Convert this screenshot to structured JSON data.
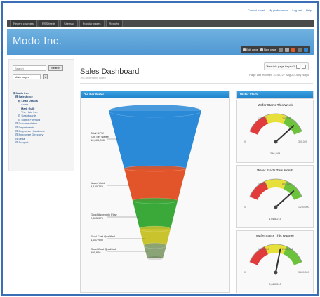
{
  "top_links": [
    "Control panel",
    "My preferences",
    "Log out",
    "Help"
  ],
  "nav": [
    "Recent changes",
    "RSS feeds",
    "Sitemap",
    "Popular pages",
    "Reports"
  ],
  "brand": "Modo Inc.",
  "tools": {
    "edit_page": "Edit page",
    "new_page": "New page"
  },
  "sidebar": {
    "search_placeholder": "Search",
    "search_button": "Search",
    "filter_value": "Main pages",
    "tree": [
      {
        "label": "Modo Inc.",
        "depth": 0,
        "bold": true
      },
      {
        "label": "Salesforce",
        "depth": 1,
        "bold": true
      },
      {
        "label": "Lead Details",
        "depth": 2,
        "bold": true
      },
      {
        "label": "Acme",
        "depth": 3,
        "bold": false
      },
      {
        "label": "Mark Gulli",
        "depth": 3,
        "bold": true
      },
      {
        "label": "The Hair, Inc.",
        "depth": 3,
        "bold": false
      },
      {
        "label": "Dashboards",
        "depth": 2,
        "bold": false
      },
      {
        "label": "Matrix Formula",
        "depth": 2,
        "bold": false
      },
      {
        "label": "Documentation",
        "depth": 1,
        "bold": false
      },
      {
        "label": "Departments",
        "depth": 1,
        "bold": false
      },
      {
        "label": "Employee Handbook",
        "depth": 1,
        "bold": false
      },
      {
        "label": "Employee Directory",
        "depth": 1,
        "bold": false
      },
      {
        "label": "Legal",
        "depth": 1,
        "bold": false
      },
      {
        "label": "Support",
        "depth": 1,
        "bold": false
      }
    ]
  },
  "page": {
    "title": "Sales Dashboard",
    "subtitle": "This page will be edited",
    "helpful_label": "Was this page helpful?",
    "modified": "Page last modified 10:42, 27 Aug 2014 by jsogo"
  },
  "funnel_panel": {
    "title": "Die Per Wafer",
    "stages": [
      {
        "label": "Total DPW",
        "sub": "(Die per wafer)",
        "value": "10,000,000",
        "color": "#2a8ad8"
      },
      {
        "label": "Wafer Yield",
        "sub": "",
        "value": "9,130,770",
        "color": "#e2552a"
      },
      {
        "label": "Good Assembly Flow",
        "sub": "",
        "value": "2,653,076",
        "color": "#3aa93a"
      },
      {
        "label": "Final Cost Qualified",
        "sub": "",
        "value": "1,637,930",
        "color": "#c9c42e"
      },
      {
        "label": "Good Cost Qualified",
        "sub": "",
        "value": "995,826",
        "color": "#8aa377"
      }
    ]
  },
  "wafer_panel": {
    "title": "Wafer Starts",
    "gauges": [
      {
        "title": "Wafer Starts This Week",
        "value_text": "256,245",
        "min": "0",
        "max": "300,000",
        "t1": "100,000",
        "t2": "200,000",
        "fraction": 0.85
      },
      {
        "title": "Wafer Starts This Month",
        "value_text": "1,015,215",
        "min": "0",
        "max": "1,200,000",
        "t1": "400,000",
        "t2": "800,000",
        "fraction": 0.85
      },
      {
        "title": "Wafer Starts This Quarter",
        "value_text": "2,080,513",
        "min": "0",
        "max": "3,600,000",
        "t1": "1,200,000",
        "t2": "2,400,000",
        "fraction": 0.58
      }
    ]
  },
  "colors": {
    "accent": "#2186cc",
    "nav_bg": "#4a4a4a",
    "banner": "#5aa3d9"
  }
}
